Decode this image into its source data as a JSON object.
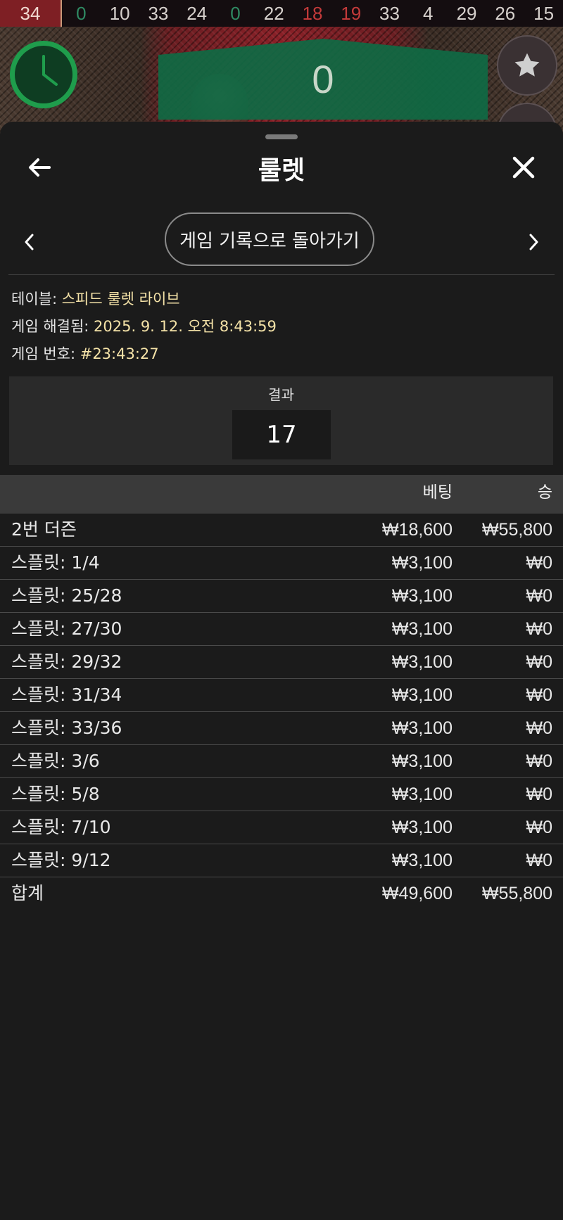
{
  "history": [
    "34",
    "0",
    "10",
    "33",
    "24",
    "0",
    "22",
    "18",
    "19",
    "33",
    "4",
    "29",
    "26",
    "15"
  ],
  "history_colors": [
    "latest",
    "green",
    "white",
    "white",
    "white",
    "green",
    "white",
    "red",
    "red",
    "white",
    "white",
    "white",
    "white",
    "white"
  ],
  "scoreboard_value": "0",
  "sheet": {
    "title": "룰렛",
    "back_icon": "arrow-left-icon",
    "close_icon": "close-icon",
    "history_button": "게임 기록으로 돌아가기"
  },
  "info": {
    "table_label": "테이블: ",
    "table_value": "스피드 룰렛 라이브",
    "resolved_label": "게임 해결됨: ",
    "resolved_value": "2025. 9. 12. 오전 8:43:59",
    "number_label": "게임 번호: ",
    "number_value": "#23:43:27"
  },
  "result": {
    "label": "결과",
    "value": "17"
  },
  "table": {
    "col_bet": "베팅",
    "col_win": "승",
    "rows": [
      {
        "name": "2번 더즌",
        "bet": "₩18,600",
        "win": "₩55,800"
      },
      {
        "name": "스플릿: 1/4",
        "bet": "₩3,100",
        "win": "₩0"
      },
      {
        "name": "스플릿: 25/28",
        "bet": "₩3,100",
        "win": "₩0"
      },
      {
        "name": "스플릿: 27/30",
        "bet": "₩3,100",
        "win": "₩0"
      },
      {
        "name": "스플릿: 29/32",
        "bet": "₩3,100",
        "win": "₩0"
      },
      {
        "name": "스플릿: 31/34",
        "bet": "₩3,100",
        "win": "₩0"
      },
      {
        "name": "스플릿: 33/36",
        "bet": "₩3,100",
        "win": "₩0"
      },
      {
        "name": "스플릿: 3/6",
        "bet": "₩3,100",
        "win": "₩0"
      },
      {
        "name": "스플릿: 5/8",
        "bet": "₩3,100",
        "win": "₩0"
      },
      {
        "name": "스플릿: 7/10",
        "bet": "₩3,100",
        "win": "₩0"
      },
      {
        "name": "스플릿: 9/12",
        "bet": "₩3,100",
        "win": "₩0"
      }
    ],
    "total": {
      "name": "합계",
      "bet": "₩49,600",
      "win": "₩55,800"
    }
  },
  "colors": {
    "accent_value": "#f5e3a8",
    "history_green": "#2f8a63",
    "history_red": "#c23a3a",
    "history_white": "#d6d0cc"
  }
}
